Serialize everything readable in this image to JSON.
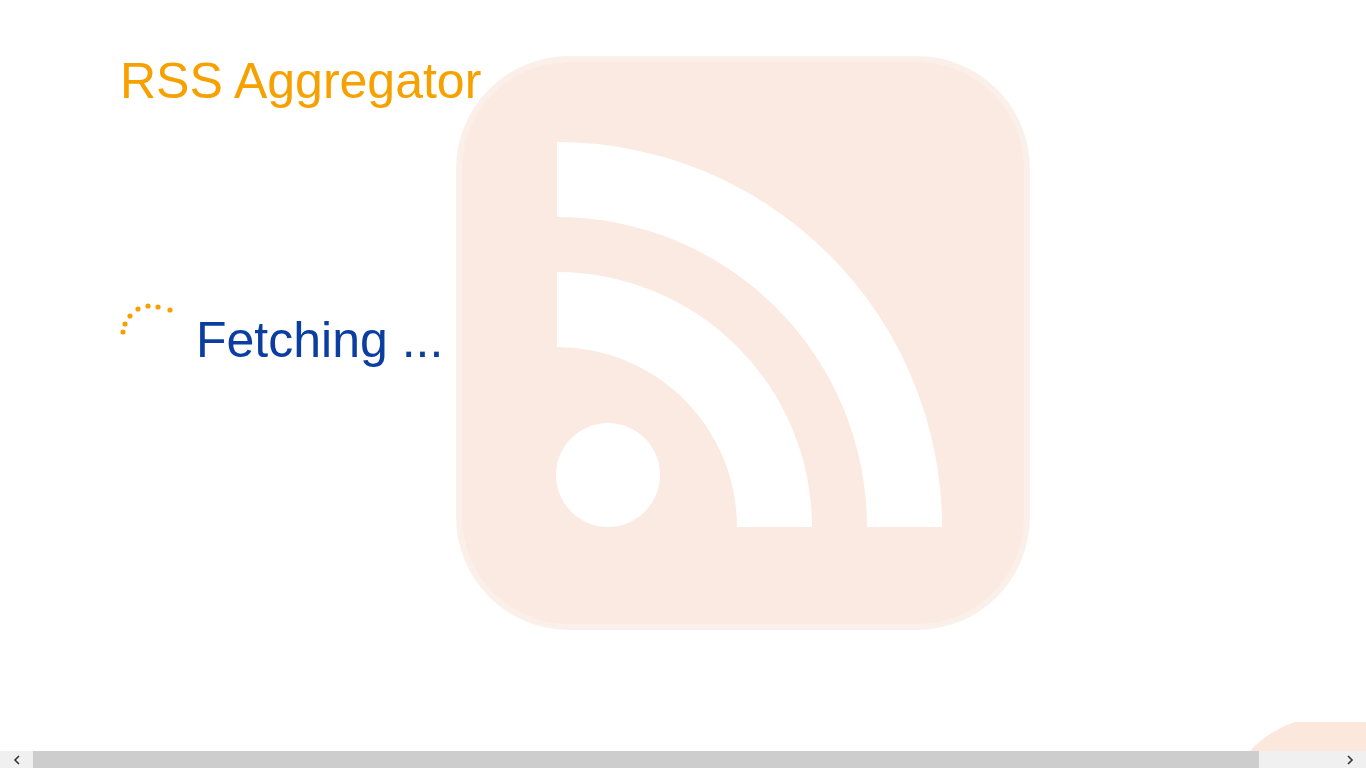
{
  "app_title": "RSS Aggregator",
  "status": {
    "text": "Fetching ...",
    "busy": true
  }
}
